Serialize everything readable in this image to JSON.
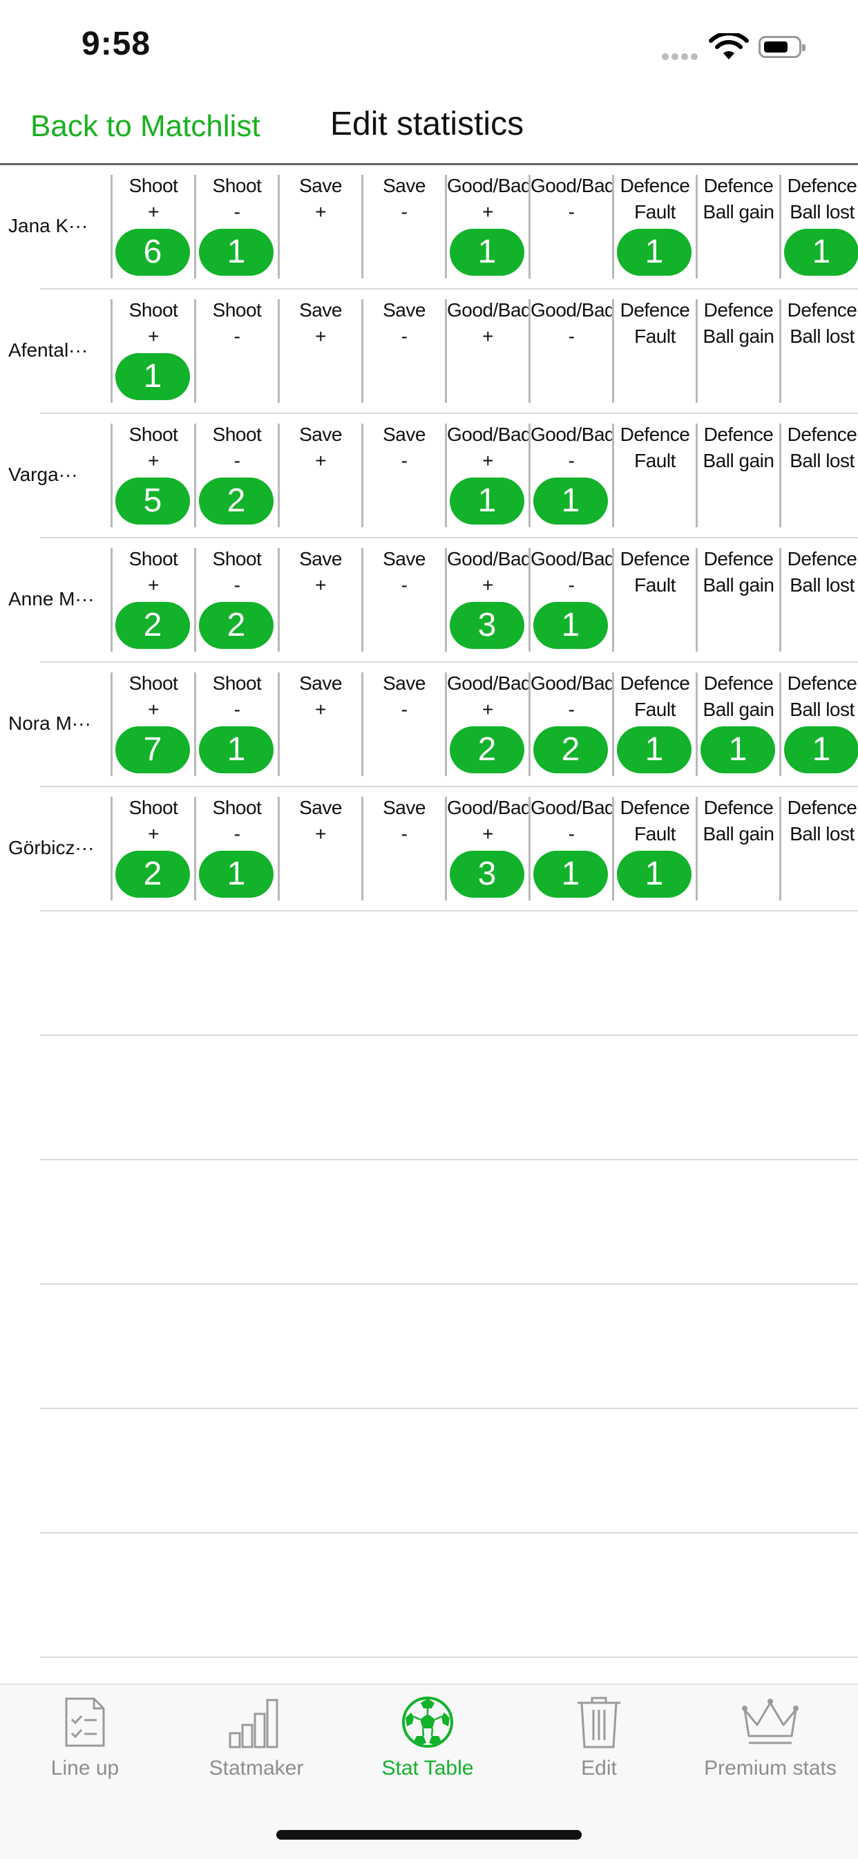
{
  "status": {
    "time": "9:58"
  },
  "nav": {
    "back_label": "Back to Matchlist",
    "title": "Edit statistics"
  },
  "columns": [
    {
      "l1": "Shoot",
      "l2": "+"
    },
    {
      "l1": "Shoot",
      "l2": "-"
    },
    {
      "l1": "Save",
      "l2": "+"
    },
    {
      "l1": "Save",
      "l2": "-"
    },
    {
      "l1": "Good/Bad",
      "l2": "+"
    },
    {
      "l1": "Good/Bad",
      "l2": "-"
    },
    {
      "l1": "Defence",
      "l2": "Fault"
    },
    {
      "l1": "Defence",
      "l2": "Ball gain"
    },
    {
      "l1": "Defence",
      "l2": "Ball lost"
    }
  ],
  "players": [
    {
      "name": "Jana K···",
      "values": [
        "6",
        "1",
        "",
        "",
        "1",
        "",
        "1",
        "",
        "1"
      ]
    },
    {
      "name": "Afental···",
      "values": [
        "1",
        "",
        "",
        "",
        "",
        "",
        "",
        "",
        ""
      ]
    },
    {
      "name": "Varga···",
      "values": [
        "5",
        "2",
        "",
        "",
        "1",
        "1",
        "",
        "",
        ""
      ]
    },
    {
      "name": "Anne M···",
      "values": [
        "2",
        "2",
        "",
        "",
        "3",
        "1",
        "",
        "",
        ""
      ]
    },
    {
      "name": "Nora M···",
      "values": [
        "7",
        "1",
        "",
        "",
        "2",
        "2",
        "1",
        "1",
        "1"
      ]
    },
    {
      "name": "Görbicz···",
      "values": [
        "2",
        "1",
        "",
        "",
        "3",
        "1",
        "1",
        "",
        ""
      ]
    }
  ],
  "tabs": [
    {
      "label": "Line up",
      "icon": "checklist-icon",
      "active": false
    },
    {
      "label": "Statmaker",
      "icon": "bar-chart-icon",
      "active": false
    },
    {
      "label": "Stat Table",
      "icon": "ball-icon",
      "active": true
    },
    {
      "label": "Edit",
      "icon": "trash-icon",
      "active": false
    },
    {
      "label": "Premium stats",
      "icon": "crown-icon",
      "active": false
    }
  ],
  "colors": {
    "accent": "#12b22b",
    "inactive": "#8e8e8e"
  }
}
